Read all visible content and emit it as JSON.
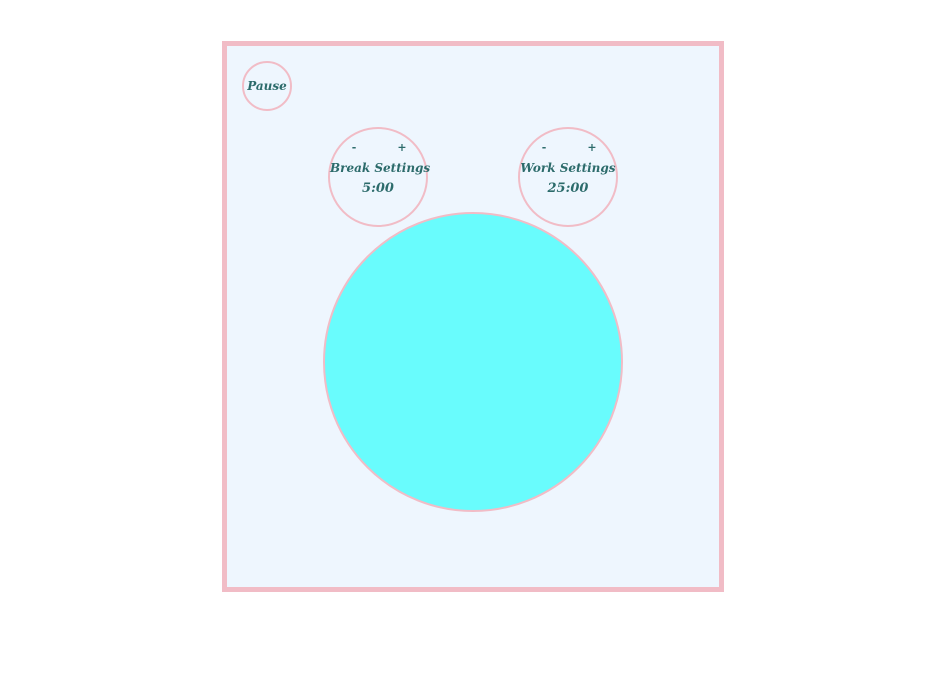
{
  "controls": {
    "pause_label": "Pause"
  },
  "break_settings": {
    "minus": "-",
    "plus": "+",
    "title": "Break Settings",
    "value": "5:00"
  },
  "work_settings": {
    "minus": "-",
    "plus": "+",
    "title": "Work Settings",
    "value": "25:00"
  },
  "colors": {
    "frame_border": "#f1bcc6",
    "frame_background": "#eef6fe",
    "text": "#2c6b6b",
    "timer_fill": "#69fcfd"
  }
}
